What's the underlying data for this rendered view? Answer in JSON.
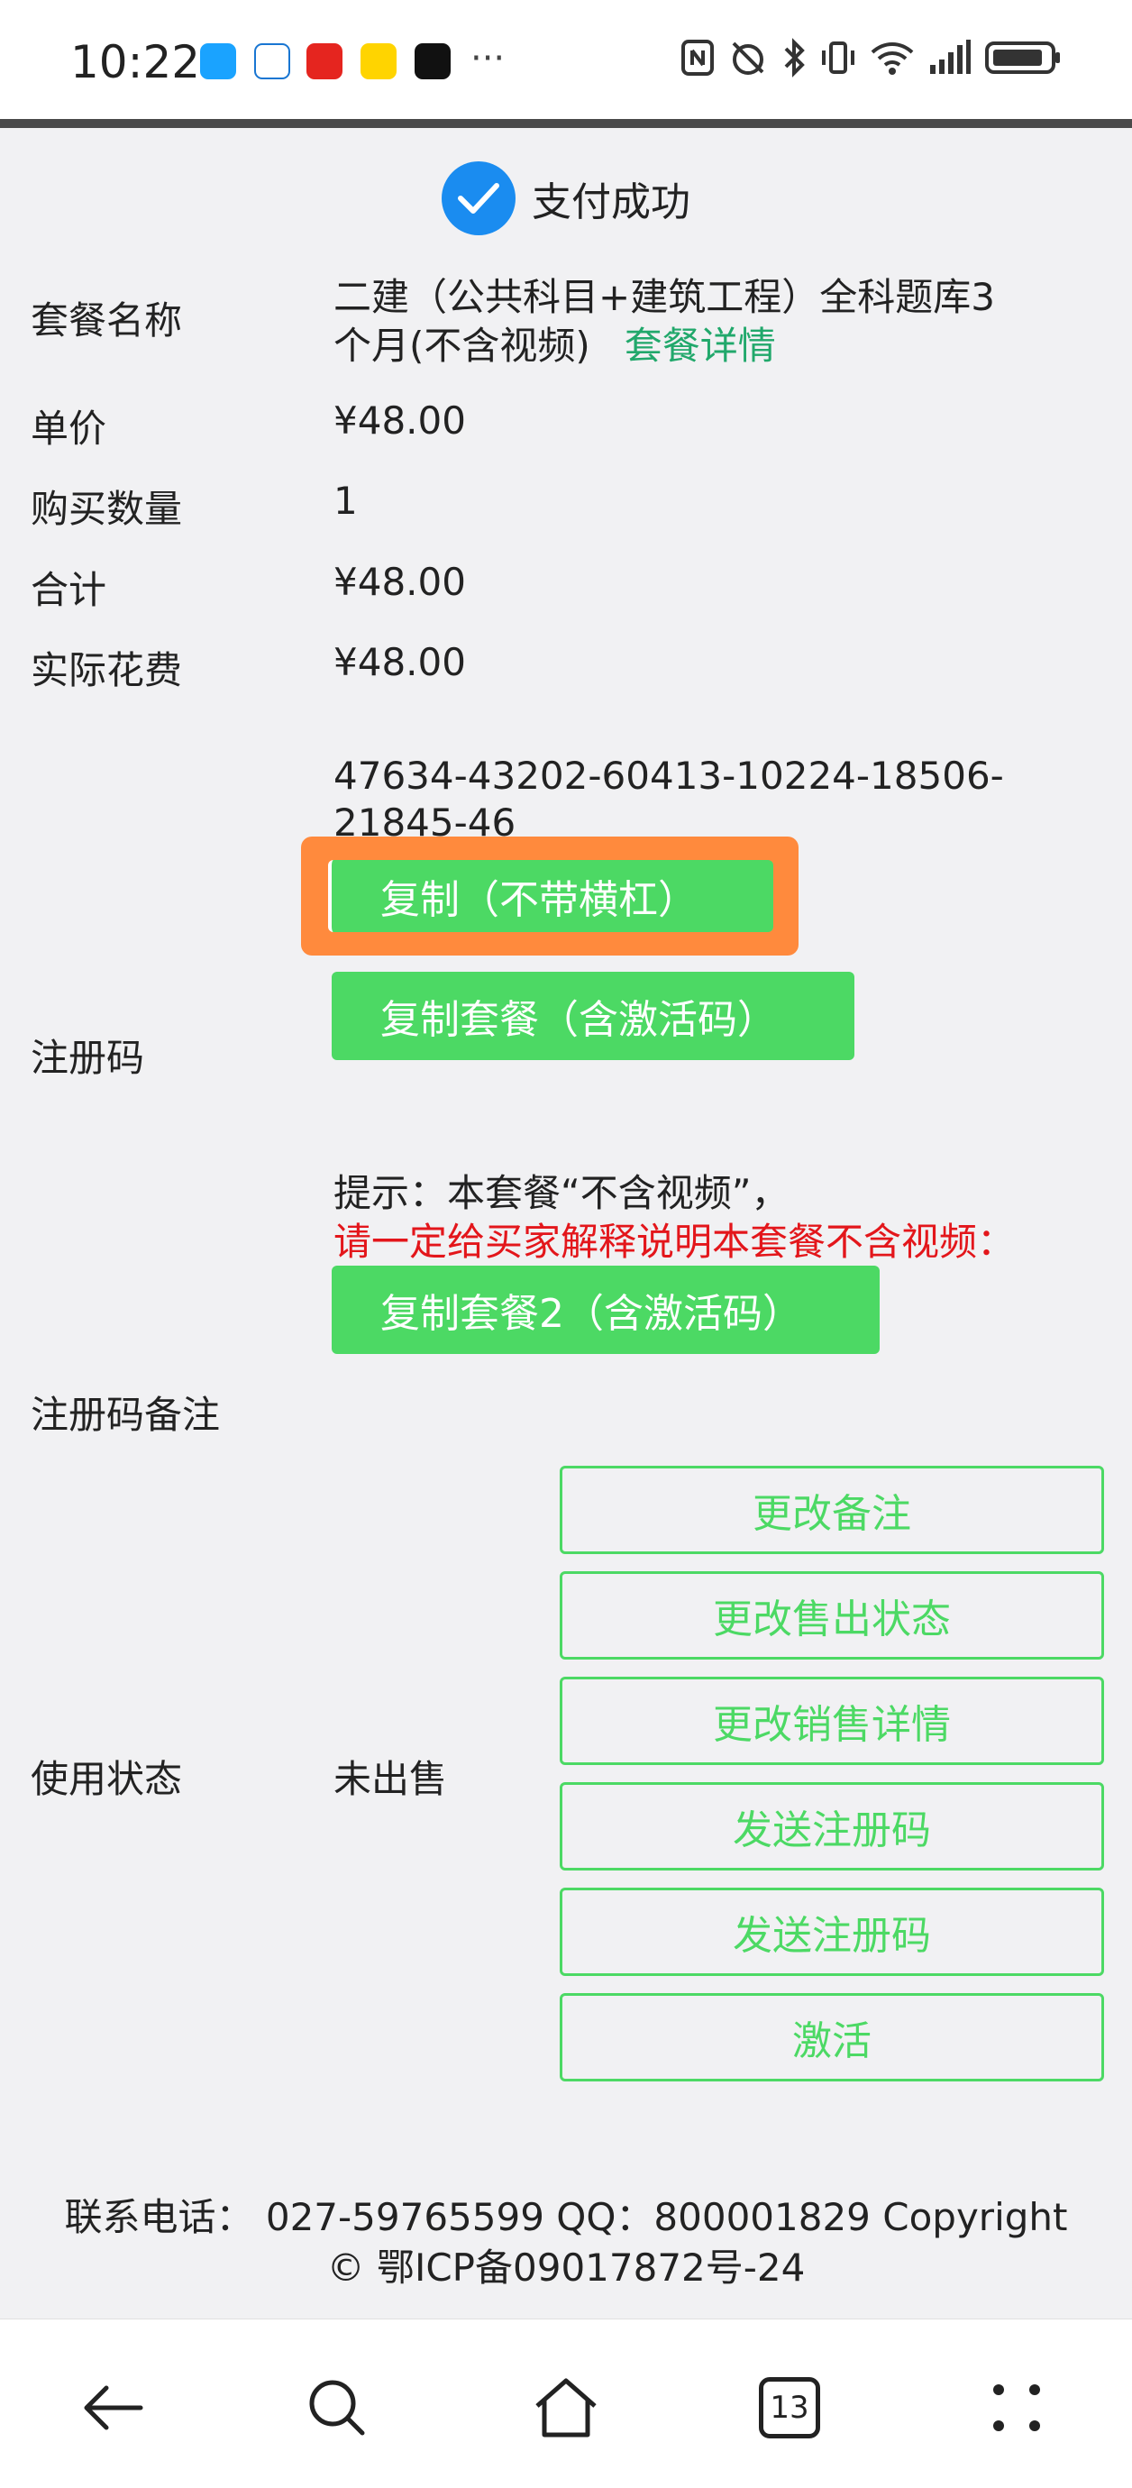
{
  "status_bar": {
    "time": "10:22",
    "more": "···",
    "battery_icon": "battery-icon"
  },
  "success": {
    "text": "支付成功"
  },
  "rows": {
    "package_name": {
      "label": "套餐名称",
      "value_line1": "二建（公共科目+建筑工程）全科题库3",
      "value_line2": "个月(不含视频)",
      "details_link": "套餐详情"
    },
    "unit_price": {
      "label": "单价",
      "value": "¥48.00"
    },
    "quantity": {
      "label": "购买数量",
      "value": "1"
    },
    "total": {
      "label": "合计",
      "value": "¥48.00"
    },
    "actual_cost": {
      "label": "实际花费",
      "value": "¥48.00"
    },
    "reg_code": {
      "label": "注册码",
      "code_line1": "47634-43202-60413-10224-18506-",
      "code_line2": "21845-46",
      "copy_no_dash": "复制（不带横杠）",
      "copy_package": "复制套餐（含激活码）",
      "hint_line1": "提示：本套餐“不含视频”，",
      "hint_line2": "请一定给买家解释说明本套餐不含视频：",
      "copy_package2": "复制套餐2（含激活码）"
    },
    "reg_note": {
      "label": "注册码备注"
    },
    "usage_status": {
      "label": "使用状态",
      "value": "未出售",
      "buttons": [
        "更改备注",
        "更改售出状态",
        "更改销售详情",
        "发送注册码",
        "发送注册码",
        "激活"
      ]
    }
  },
  "footer": {
    "line1": "联系电话： 027-59765599 QQ：800001829 Copyright",
    "line2": "© 鄂ICP备09017872号-24"
  },
  "nav": {
    "tab_count": "13"
  },
  "colors": {
    "green": "#4cd964",
    "link_green": "#21a86b",
    "red": "#e3161b",
    "blue": "#1a8cf0",
    "highlight": "#ff8a3d"
  }
}
